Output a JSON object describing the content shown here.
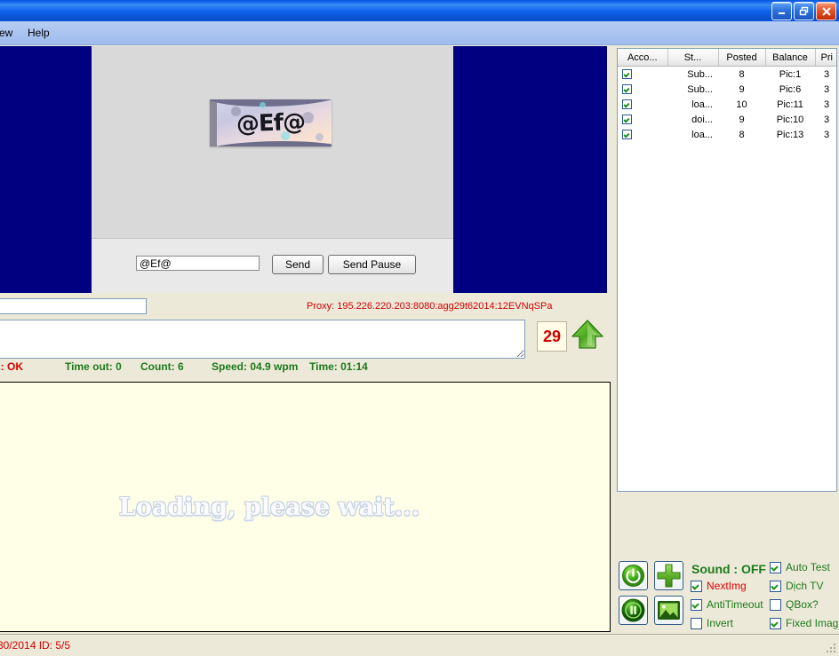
{
  "window": {
    "title": "",
    "buttons": {
      "minimize": "minimize-button",
      "restore": "restore-button",
      "close": "close-button"
    }
  },
  "menubar": {
    "items": [
      {
        "label": "ew"
      },
      {
        "label": "Help"
      }
    ]
  },
  "captcha": {
    "image_text": "@Ef@",
    "answer_value": "@Ef@",
    "answer_placeholder": "",
    "send_label": "Send",
    "send_pause_label": "Send Pause"
  },
  "proxy": {
    "text": "Proxy: 195.226.220.203:8080:agg29t62014:12EVNqSPa"
  },
  "log": {
    "left_input_value": "",
    "textarea_value": ""
  },
  "counter": {
    "value": "29",
    "arrow_icon": "up-arrow-icon"
  },
  "stats": [
    {
      "label": "s: OK",
      "color": "red"
    },
    {
      "label": "Time out: 0",
      "color": "green"
    },
    {
      "label": "Count: 6",
      "color": "green"
    },
    {
      "label": "Speed: 04.9 wpm",
      "color": "green"
    },
    {
      "label": "Time: 01:14",
      "color": "green"
    }
  ],
  "loading": {
    "text": "Loading, please wait..."
  },
  "statusbar": {
    "text": "30/2014  ID: 5/5"
  },
  "accounts": {
    "columns": [
      "Acco...",
      "St...",
      "Posted",
      "Balance",
      "Pri"
    ],
    "rows": [
      {
        "checked": true,
        "acco": "",
        "st": "Sub...",
        "posted": "8",
        "balance": "Pic:1",
        "pri": "3"
      },
      {
        "checked": true,
        "acco": "",
        "st": "Sub...",
        "posted": "9",
        "balance": "Pic:6",
        "pri": "3"
      },
      {
        "checked": true,
        "acco": "",
        "st": "loa...",
        "posted": "10",
        "balance": "Pic:11",
        "pri": "3"
      },
      {
        "checked": true,
        "acco": "",
        "st": "doi...",
        "posted": "9",
        "balance": "Pic:10",
        "pri": "3"
      },
      {
        "checked": true,
        "acco": "",
        "st": "loa...",
        "posted": "8",
        "balance": "Pic:13",
        "pri": "3"
      }
    ]
  },
  "controls": {
    "sound_label": "Sound : OFF",
    "buttons": [
      {
        "icon": "power-icon"
      },
      {
        "icon": "plus-icon"
      },
      {
        "icon": "pause-icon"
      },
      {
        "icon": "image-icon"
      }
    ],
    "checkboxes_left": [
      {
        "label": "NextImg",
        "checked": true,
        "color": "red"
      },
      {
        "label": "AntiTimeout",
        "checked": true,
        "color": "green"
      },
      {
        "label": "Invert",
        "checked": false,
        "color": "green"
      }
    ],
    "checkboxes_right": [
      {
        "label": "Auto Test",
        "checked": true,
        "color": "green"
      },
      {
        "label": "Dịch TV",
        "checked": true,
        "color": "green"
      },
      {
        "label": "QBox?",
        "checked": false,
        "color": "green"
      },
      {
        "label": "Fixed Imag",
        "checked": true,
        "color": "green"
      }
    ]
  },
  "colors": {
    "titlebar_blue": "#1163ec",
    "navy": "#000080",
    "accent_green": "#1d7a1d",
    "accent_red": "#d40000",
    "panel": "#ece9d8",
    "loading_bg": "#ffffe8"
  }
}
